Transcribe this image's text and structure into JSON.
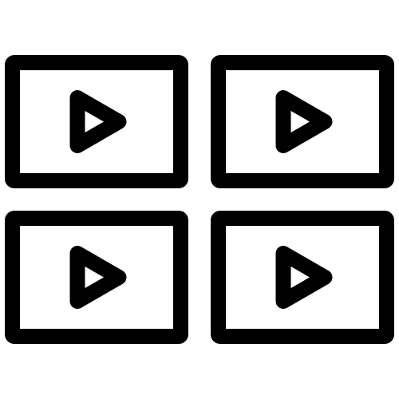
{
  "icon": {
    "name": "video-gallery-grid-icon",
    "stroke_color": "#000000",
    "background_color": "#ffffff",
    "tiles": [
      {
        "name": "video-tile-top-left",
        "glyph": "play-icon"
      },
      {
        "name": "video-tile-top-right",
        "glyph": "play-icon"
      },
      {
        "name": "video-tile-bottom-left",
        "glyph": "play-icon"
      },
      {
        "name": "video-tile-bottom-right",
        "glyph": "play-icon"
      }
    ]
  }
}
